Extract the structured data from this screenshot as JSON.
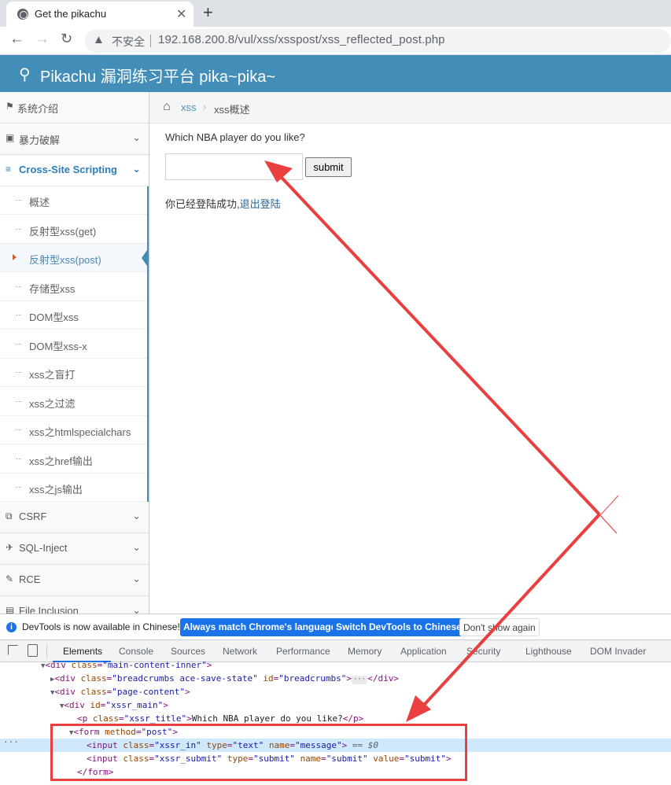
{
  "browser": {
    "tab_title": "Get the pikachu",
    "new_tab_label": "+",
    "tab_close_label": "✕",
    "insecure_label": "不安全",
    "url": "192.168.200.8/vul/xss/xsspost/xss_reflected_post.php"
  },
  "header": {
    "brand": "Pikachu 漏洞练习平台 pika~pika~"
  },
  "sidebar": {
    "items": [
      {
        "label": "系统介绍",
        "icon": "tag-icon"
      },
      {
        "label": "暴力破解",
        "icon": "lock-icon"
      },
      {
        "label": "Cross-Site Scripting",
        "icon": "list-icon"
      },
      {
        "label": "CSRF",
        "icon": "share-icon"
      },
      {
        "label": "SQL-Inject",
        "icon": "plane-icon"
      },
      {
        "label": "RCE",
        "icon": "pencil-icon"
      },
      {
        "label": "File Inclusion",
        "icon": "file-icon"
      }
    ],
    "submenu": [
      "概述",
      "反射型xss(get)",
      "反射型xss(post)",
      "存储型xss",
      "DOM型xss",
      "DOM型xss-x",
      "xss之盲打",
      "xss之过滤",
      "xss之htmlspecialchars",
      "xss之href输出",
      "xss之js输出"
    ]
  },
  "breadcrumb": {
    "section": "xss",
    "current": "xss概述"
  },
  "main": {
    "question": "Which NBA player do you like?",
    "input_value": "",
    "submit_label": "submit",
    "login_text": "你已经登陆成功,",
    "logout_label": "退出登陆"
  },
  "devtools": {
    "info_text": "DevTools is now available in Chinese!",
    "btn_match": "Always match Chrome's language",
    "btn_switch": "Switch DevTools to Chinese",
    "btn_dismiss": "Don't show again",
    "tabs": [
      "Elements",
      "Console",
      "Sources",
      "Network",
      "Performance",
      "Memory",
      "Application",
      "Security",
      "Lighthouse",
      "DOM Invader"
    ],
    "active_tab": "Elements",
    "selected_marker": "== $0",
    "gutter": "···"
  },
  "colors": {
    "header_bg": "#438eb9",
    "link": "#4c8fbd",
    "annotation_red": "#e9403f",
    "devtools_selected": "#cfe8fc"
  }
}
